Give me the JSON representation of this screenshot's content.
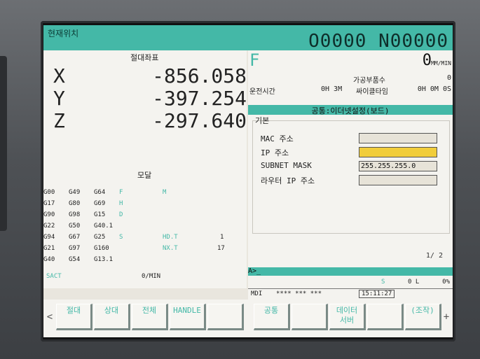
{
  "topbar": {
    "mode": "현재위치",
    "program": "O0000 N00000"
  },
  "position": {
    "header": "절대좌표",
    "axes": [
      {
        "axis": "X",
        "value": "-856.058"
      },
      {
        "axis": "Y",
        "value": "-397.254"
      },
      {
        "axis": "Z",
        "value": "-297.640"
      }
    ]
  },
  "feed": {
    "label": "F",
    "value": "0",
    "unit": "MM/MIN"
  },
  "times": {
    "parts_label": "가공부품수",
    "parts_value": "0",
    "run_label": "운전시간",
    "run_value": "0H 3M",
    "cycle_label": "싸이클타임",
    "cycle_value": "0H 0M 0S"
  },
  "ethernet": {
    "title": "공통:이더넷설정(보드)",
    "group": "기본",
    "fields": [
      {
        "label": "MAC 주소",
        "value": ""
      },
      {
        "label": "IP 주소",
        "value": ""
      },
      {
        "label": "SUBNET MASK",
        "value": "255.255.255.0"
      },
      {
        "label": "라우터 IP 주소",
        "value": ""
      }
    ],
    "page": "1/ 2"
  },
  "modal": {
    "header": "모달",
    "rows": [
      [
        "G00",
        "G49",
        "G64",
        "F",
        "M"
      ],
      [
        "G17",
        "G80",
        "G69",
        "H",
        ""
      ],
      [
        "G90",
        "G98",
        "G15",
        "D",
        ""
      ],
      [
        "G22",
        "G50",
        "G40.1",
        "",
        ""
      ],
      [
        "G94",
        "G67",
        "G25",
        "S",
        "HD.T",
        "1"
      ],
      [
        "G21",
        "G97",
        "G160",
        "",
        "NX.T",
        "17"
      ],
      [
        "G40",
        "G54",
        "G13.1",
        "",
        "",
        ""
      ]
    ]
  },
  "sact": {
    "label": "SACT",
    "value": "0/MIN"
  },
  "input_prompt": "A>_",
  "status": {
    "s_label": "S",
    "l_value": "0 L",
    "percent": "0%",
    "mode": "MDI",
    "state": "**** *** ***",
    "time": "15:11:27"
  },
  "softkeys": {
    "left": [
      "절대",
      "상대",
      "전체",
      "HANDLE",
      ""
    ],
    "right": [
      "공통",
      "",
      "데이터\n서버",
      "",
      "(조작)"
    ]
  }
}
